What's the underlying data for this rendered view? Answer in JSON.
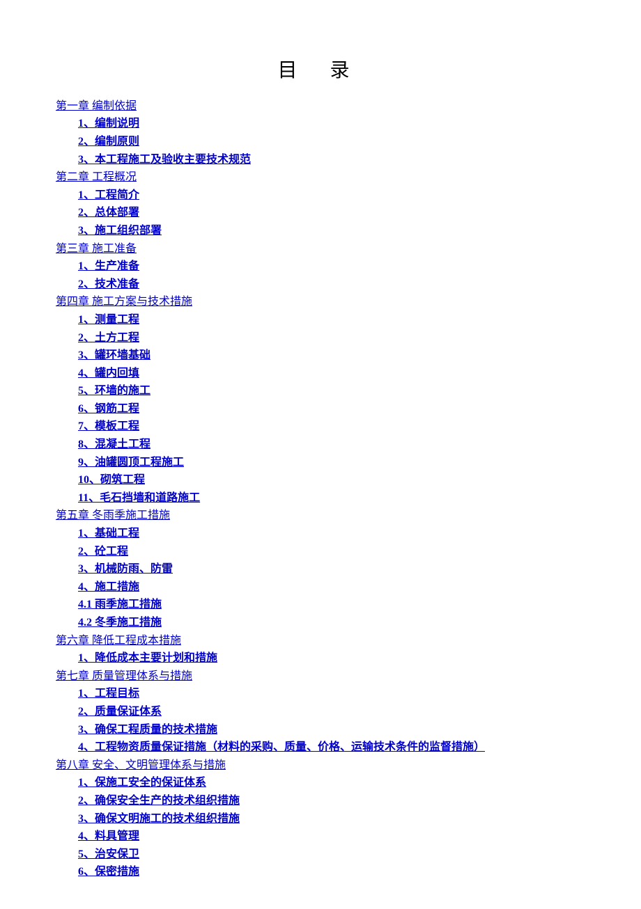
{
  "title": "目  录",
  "chapters": [
    {
      "title": "第一章  编制依据",
      "sections": [
        "1、编制说明",
        "2、编制原则",
        "3、本工程施工及验收主要技术规范"
      ]
    },
    {
      "title": "第二章  工程概况",
      "sections": [
        "1、工程简介",
        "2、总体部署",
        "3、施工组织部署"
      ]
    },
    {
      "title": "第三章  施工准备",
      "sections": [
        "1、生产准备",
        "2、技术准备"
      ]
    },
    {
      "title": "第四章  施工方案与技术措施",
      "sections": [
        "1、测量工程",
        "2、土方工程",
        "3、罐环墙基础",
        "4、罐内回填",
        "5、环墙的施工",
        "6、钢筋工程",
        "7、模板工程",
        "8、混凝土工程",
        "9、油罐圆顶工程施工",
        "10、砌筑工程",
        "11、毛石挡墙和道路施工"
      ]
    },
    {
      "title": "第五章  冬雨季施工措施",
      "sections": [
        "1、基础工程",
        "2、砼工程",
        "3、机械防雨、防雷",
        "4、施工措施",
        "4.1 雨季施工措施",
        "4.2 冬季施工措施"
      ]
    },
    {
      "title": "第六章  降低工程成本措施",
      "sections": [
        "1、降低成本主要计划和措施"
      ]
    },
    {
      "title": "第七章  质量管理体系与措施",
      "sections": [
        "1、工程目标",
        "2、质量保证体系",
        "3、确保工程质量的技术措施",
        "4、工程物资质量保证措施（材料的采购、质量、价格、运输技术条件的监督措施）"
      ]
    },
    {
      "title": "第八章  安全、文明管理体系与措施",
      "sections": [
        "1、保施工安全的保证体系",
        "2、确保安全生产的技术组织措施",
        "3、确保文明施工的技术组织措施",
        "4、料具管理",
        "5、治安保卫",
        "6、保密措施"
      ]
    }
  ]
}
